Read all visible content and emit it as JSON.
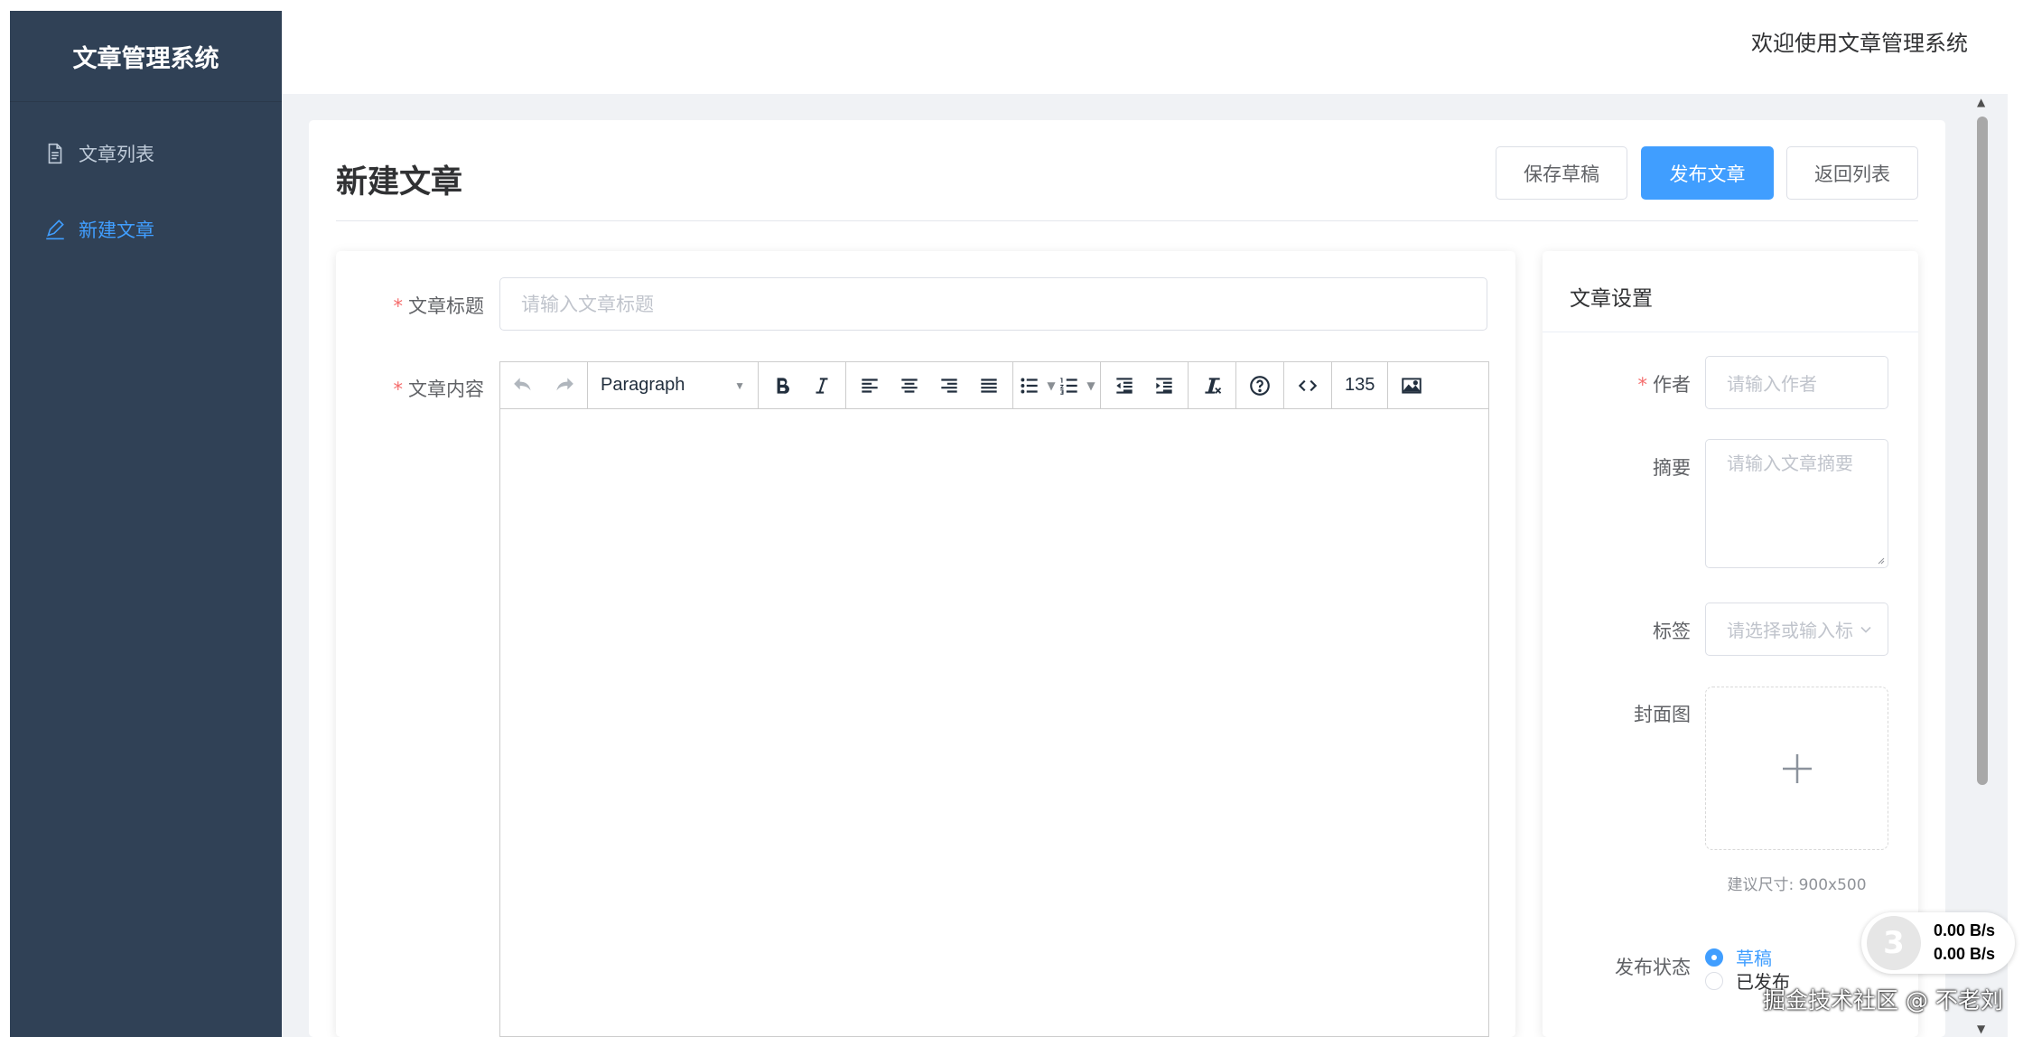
{
  "sidebar": {
    "brand": "文章管理系统",
    "items": [
      {
        "label": "文章列表",
        "icon": "document-icon",
        "active": false
      },
      {
        "label": "新建文章",
        "icon": "edit-icon",
        "active": true
      }
    ]
  },
  "header": {
    "welcome": "欢迎使用文章管理系统"
  },
  "page": {
    "title": "新建文章",
    "buttons": {
      "save_draft": "保存草稿",
      "publish": "发布文章",
      "back_to_list": "返回列表"
    }
  },
  "form": {
    "title_label": "文章标题",
    "title_placeholder": "请输入文章标题",
    "content_label": "文章内容",
    "editor": {
      "block_format": "Paragraph",
      "word_count": "135"
    }
  },
  "settings": {
    "title": "文章设置",
    "author_label": "作者",
    "author_placeholder": "请输入作者",
    "summary_label": "摘要",
    "summary_placeholder": "请输入文章摘要",
    "tags_label": "标签",
    "tags_placeholder": "请选择或输入标",
    "cover_label": "封面图",
    "cover_tip": "建议尺寸: 900x500",
    "status_label": "发布状态",
    "status_options": [
      {
        "label": "草稿",
        "checked": true
      },
      {
        "label": "已发布",
        "checked": false
      }
    ]
  },
  "net_widget": {
    "upload": "0.00 B/s",
    "download": "0.00 B/s"
  },
  "watermark": "掘金技术社区 @ 不老刘",
  "colors": {
    "primary": "#409eff",
    "sidebar": "#304156",
    "required": "#f56c6c"
  }
}
